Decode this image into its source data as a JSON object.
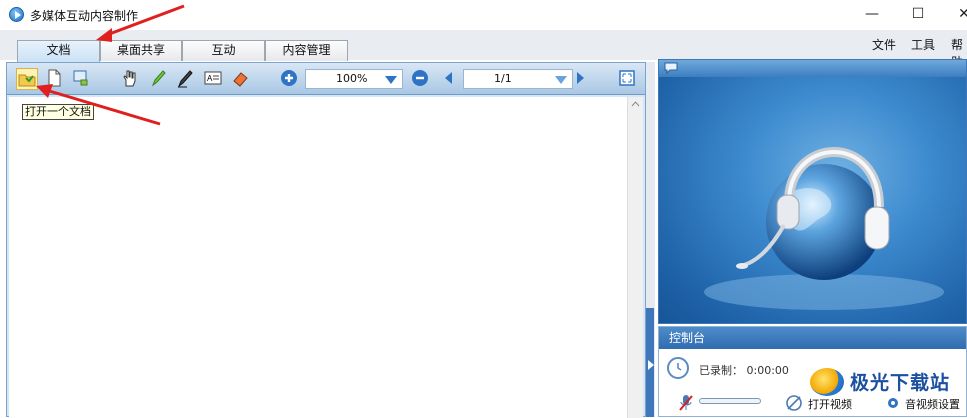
{
  "window": {
    "title": "多媒体互动内容制作",
    "controls": {
      "minimize": "—",
      "maximize": "☐",
      "close": "✕"
    }
  },
  "tabs": [
    {
      "label": "文档",
      "active": true
    },
    {
      "label": "桌面共享",
      "active": false
    },
    {
      "label": "互动",
      "active": false
    },
    {
      "label": "内容管理",
      "active": false
    }
  ],
  "menu": {
    "file": "文件",
    "tools": "工具",
    "help": "帮助"
  },
  "toolbar": {
    "zoom": "100%",
    "page": "1/1",
    "icons": [
      "open-folder-icon",
      "new-document-icon",
      "export-icon",
      "hand-icon",
      "highlighter-icon",
      "pen-icon",
      "text-box-icon",
      "eraser-icon",
      "zoom-in-icon",
      "zoom-out-icon",
      "prev-page-icon",
      "next-page-icon",
      "fit-page-icon"
    ]
  },
  "tooltip": "打开一个文档",
  "console": {
    "title": "控制台",
    "recorded_label": "已录制：",
    "recorded_time": "0:00:00",
    "open_video": "打开视频",
    "av_settings": "音视频设置"
  },
  "watermark": {
    "text": "极光下载站"
  },
  "colors": {
    "accent": "#3e77ba",
    "annotation_arrow": "#e02020",
    "tooltip_bg": "#ffffe1"
  }
}
